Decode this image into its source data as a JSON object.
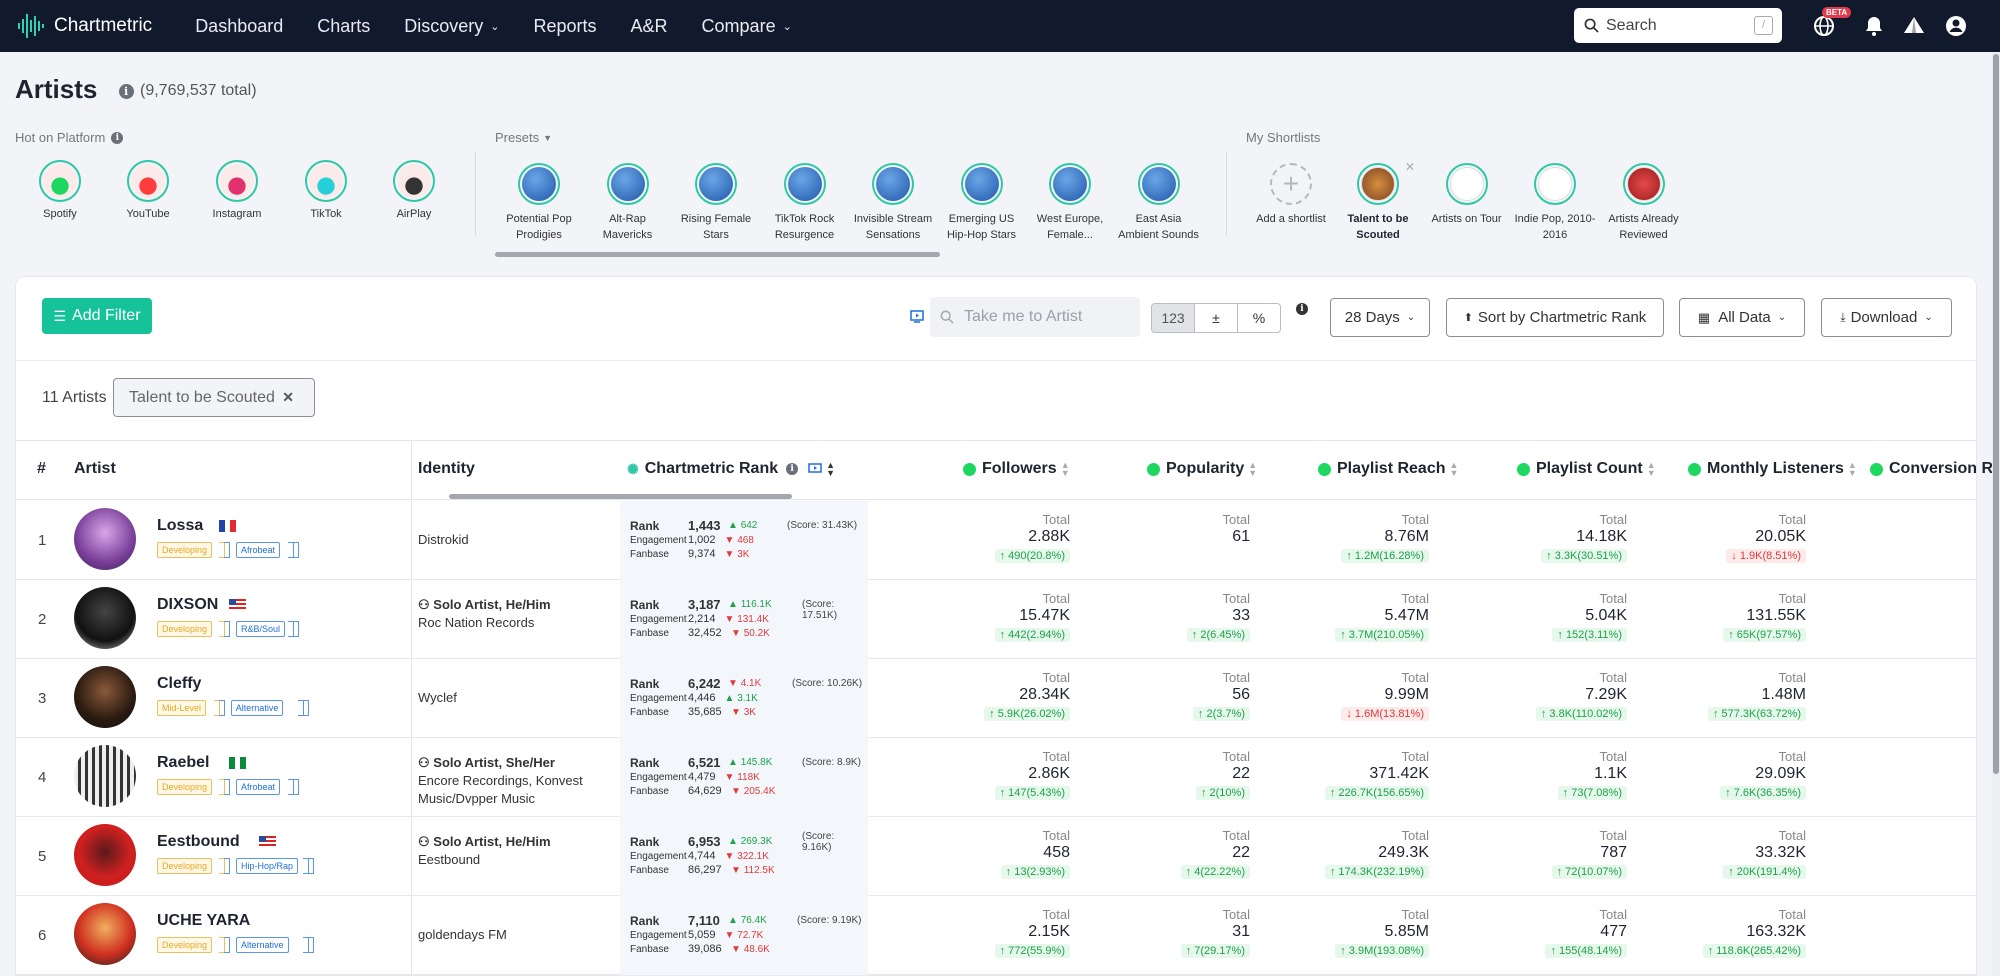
{
  "nav": {
    "brand": "Chartmetric",
    "items": [
      {
        "label": "Dashboard",
        "dropdown": false
      },
      {
        "label": "Charts",
        "dropdown": false
      },
      {
        "label": "Discovery",
        "dropdown": true
      },
      {
        "label": "Reports",
        "dropdown": false
      },
      {
        "label": "A&R",
        "dropdown": false
      },
      {
        "label": "Compare",
        "dropdown": true
      }
    ],
    "search_placeholder": "Search",
    "search_shortcut": "/",
    "beta_badge": "BETA"
  },
  "page": {
    "title": "Artists",
    "total": "(9,769,537 total)"
  },
  "hot_on_platform": {
    "label": "Hot on Platform",
    "platforms": [
      {
        "label": "Spotify",
        "color": "#1ed760"
      },
      {
        "label": "YouTube",
        "color": "#ff3b3b"
      },
      {
        "label": "Instagram",
        "color": "#e1306c"
      },
      {
        "label": "TikTok",
        "color": "#25d0d8"
      },
      {
        "label": "AirPlay",
        "color": "#333333"
      }
    ]
  },
  "presets": {
    "label": "Presets",
    "items": [
      {
        "line1": "Potential Pop",
        "line2": "Prodigies"
      },
      {
        "line1": "Alt-Rap",
        "line2": "Mavericks"
      },
      {
        "line1": "Rising Female",
        "line2": "Stars"
      },
      {
        "line1": "TikTok Rock",
        "line2": "Resurgence"
      },
      {
        "line1": "Invisible Stream",
        "line2": "Sensations"
      },
      {
        "line1": "Emerging US",
        "line2": "Hip-Hop Stars"
      },
      {
        "line1": "West Europe,",
        "line2": "Female..."
      },
      {
        "line1": "East Asia",
        "line2": "Ambient Sounds"
      }
    ]
  },
  "shortlists": {
    "label": "My Shortlists",
    "add_label": "Add a shortlist",
    "items": [
      {
        "line1": "Talent to be",
        "line2": "Scouted",
        "selected": true
      },
      {
        "line1": "Artists on Tour",
        "line2": "",
        "selected": false
      },
      {
        "line1": "Indie Pop, 2010-",
        "line2": "2016",
        "selected": false
      },
      {
        "line1": "Artists Already",
        "line2": "Reviewed",
        "selected": false
      }
    ]
  },
  "toolbar": {
    "add_filter": "Add Filter",
    "take_me_placeholder": "Take me to Artist",
    "seg_123": "123",
    "seg_diff": "±",
    "seg_pct": "%",
    "days": "28 Days",
    "sort": "Sort by Chartmetric Rank",
    "all_data": "All Data",
    "download": "Download"
  },
  "filter": {
    "count": "11 Artists",
    "chip": "Talent to be Scouted"
  },
  "columns": {
    "num": "#",
    "artist": "Artist",
    "identity": "Identity",
    "rank": "Chartmetric Rank",
    "followers": "Followers",
    "popularity": "Popularity",
    "playlist_reach": "Playlist Reach",
    "playlist_count": "Playlist Count",
    "monthly_listeners": "Monthly Listeners",
    "conversion": "Conversion R"
  },
  "labels": {
    "rank": "Rank",
    "engagement": "Engagement",
    "fanbase": "Fanbase",
    "total": "Total"
  },
  "rows": [
    {
      "num": "1",
      "name": "Lossa",
      "flag": "fr",
      "stage": "Developing",
      "genre": "Afrobeat",
      "identity_role": "",
      "identity_label": "Distrokid",
      "rank": "1,443",
      "rank_delta": "642",
      "rank_dir": "up",
      "score": "(Score: 31.43K)",
      "eng": "1,002",
      "eng_delta": "468",
      "eng_dir": "dn",
      "fan": "9,374",
      "fan_delta": "3K",
      "fan_dir": "dn",
      "followers": {
        "v": "2.88K",
        "c": "490(20.8%)",
        "dir": "up"
      },
      "popularity": {
        "v": "61",
        "c": "",
        "dir": "up"
      },
      "reach": {
        "v": "8.76M",
        "c": "1.2M(16.28%)",
        "dir": "up"
      },
      "pcount": {
        "v": "14.18K",
        "c": "3.3K(30.51%)",
        "dir": "up"
      },
      "ml": {
        "v": "20.05K",
        "c": "1.9K(8.51%)",
        "dir": "dn"
      }
    },
    {
      "num": "2",
      "name": "DIXSON",
      "flag": "us",
      "stage": "Developing",
      "genre": "R&B/Soul",
      "identity_role": "Solo Artist, He/Him",
      "identity_label": "Roc Nation Records",
      "rank": "3,187",
      "rank_delta": "116.1K",
      "rank_dir": "up",
      "score": "(Score: 17.51K)",
      "eng": "2,214",
      "eng_delta": "131.4K",
      "eng_dir": "dn",
      "fan": "32,452",
      "fan_delta": "50.2K",
      "fan_dir": "dn",
      "followers": {
        "v": "15.47K",
        "c": "442(2.94%)",
        "dir": "up"
      },
      "popularity": {
        "v": "33",
        "c": "2(6.45%)",
        "dir": "up"
      },
      "reach": {
        "v": "5.47M",
        "c": "3.7M(210.05%)",
        "dir": "up"
      },
      "pcount": {
        "v": "5.04K",
        "c": "152(3.11%)",
        "dir": "up"
      },
      "ml": {
        "v": "131.55K",
        "c": "65K(97.57%)",
        "dir": "up"
      }
    },
    {
      "num": "3",
      "name": "Cleffy",
      "flag": "",
      "stage": "Mid-Level",
      "genre": "Alternative",
      "identity_role": "",
      "identity_label": "Wyclef",
      "rank": "6,242",
      "rank_delta": "4.1K",
      "rank_dir": "dn",
      "score": "(Score: 10.26K)",
      "eng": "4,446",
      "eng_delta": "3.1K",
      "eng_dir": "up",
      "fan": "35,685",
      "fan_delta": "3K",
      "fan_dir": "dn",
      "followers": {
        "v": "28.34K",
        "c": "5.9K(26.02%)",
        "dir": "up"
      },
      "popularity": {
        "v": "56",
        "c": "2(3.7%)",
        "dir": "up"
      },
      "reach": {
        "v": "9.99M",
        "c": "1.6M(13.81%)",
        "dir": "dn"
      },
      "pcount": {
        "v": "7.29K",
        "c": "3.8K(110.02%)",
        "dir": "up"
      },
      "ml": {
        "v": "1.48M",
        "c": "577.3K(63.72%)",
        "dir": "up"
      }
    },
    {
      "num": "4",
      "name": "Raebel",
      "flag": "ng",
      "stage": "Developing",
      "genre": "Afrobeat",
      "identity_role": "Solo Artist, She/Her",
      "identity_label": "Encore Recordings, Konvest",
      "identity_label2": "Music/Dvpper Music",
      "rank": "6,521",
      "rank_delta": "145.8K",
      "rank_dir": "up",
      "score": "(Score: 8.9K)",
      "eng": "4,479",
      "eng_delta": "118K",
      "eng_dir": "dn",
      "fan": "64,629",
      "fan_delta": "205.4K",
      "fan_dir": "dn",
      "followers": {
        "v": "2.86K",
        "c": "147(5.43%)",
        "dir": "up"
      },
      "popularity": {
        "v": "22",
        "c": "2(10%)",
        "dir": "up"
      },
      "reach": {
        "v": "371.42K",
        "c": "226.7K(156.65%)",
        "dir": "up"
      },
      "pcount": {
        "v": "1.1K",
        "c": "73(7.08%)",
        "dir": "up"
      },
      "ml": {
        "v": "29.09K",
        "c": "7.6K(36.35%)",
        "dir": "up"
      }
    },
    {
      "num": "5",
      "name": "Eestbound",
      "flag": "us",
      "stage": "Developing",
      "genre": "Hip-Hop/Rap",
      "identity_role": "Solo Artist, He/Him",
      "identity_label": "Eestbound",
      "rank": "6,953",
      "rank_delta": "269.3K",
      "rank_dir": "up",
      "score": "(Score:",
      "score2": "9.16K)",
      "eng": "4,744",
      "eng_delta": "322.1K",
      "eng_dir": "dn",
      "fan": "86,297",
      "fan_delta": "112.5K",
      "fan_dir": "dn",
      "followers": {
        "v": "458",
        "c": "13(2.93%)",
        "dir": "up"
      },
      "popularity": {
        "v": "22",
        "c": "4(22.22%)",
        "dir": "up"
      },
      "reach": {
        "v": "249.3K",
        "c": "174.3K(232.19%)",
        "dir": "up"
      },
      "pcount": {
        "v": "787",
        "c": "72(10.07%)",
        "dir": "up"
      },
      "ml": {
        "v": "33.32K",
        "c": "20K(191.4%)",
        "dir": "up"
      }
    },
    {
      "num": "6",
      "name": "UCHE YARA",
      "flag": "",
      "stage": "Developing",
      "genre": "Alternative",
      "identity_role": "",
      "identity_label": "goldendays FM",
      "rank": "7,110",
      "rank_delta": "76.4K",
      "rank_dir": "up",
      "score": "(Score: 9.19K)",
      "eng": "5,059",
      "eng_delta": "72.7K",
      "eng_dir": "dn",
      "fan": "39,086",
      "fan_delta": "48.6K",
      "fan_dir": "dn",
      "followers": {
        "v": "2.15K",
        "c": "772(55.9%)",
        "dir": "up"
      },
      "popularity": {
        "v": "31",
        "c": "7(29.17%)",
        "dir": "up"
      },
      "reach": {
        "v": "5.85M",
        "c": "3.9M(193.08%)",
        "dir": "up"
      },
      "pcount": {
        "v": "477",
        "c": "155(48.14%)",
        "dir": "up"
      },
      "ml": {
        "v": "163.32K",
        "c": "118.6K(265.42%)",
        "dir": "up"
      }
    }
  ],
  "colors": {
    "accent": "#15c29a",
    "nav_bg": "#111a2c",
    "up": "#1ea24a",
    "down": "#e03b3b"
  }
}
